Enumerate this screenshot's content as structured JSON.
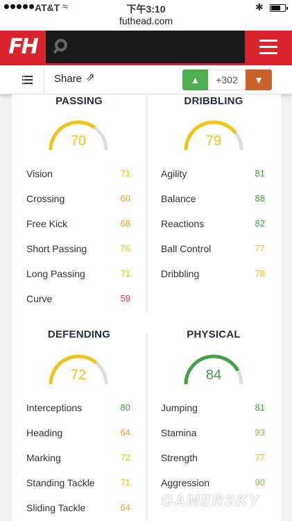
{
  "status_bar": {
    "carrier": "AT&T",
    "time": "下午3:10"
  },
  "browser": {
    "url": "futhead.com"
  },
  "header": {
    "logo_text": "FH",
    "search_placeholder": ""
  },
  "share_bar": {
    "share_label": "Share",
    "vote_count": "+302"
  },
  "colors": {
    "accent_red": "#d9232d",
    "yellow": "#f0c419",
    "light_green": "#8bc34a",
    "green": "#43a047",
    "red": "#e53935",
    "gauge_track": "#dddddd"
  },
  "sections": {
    "passing": {
      "title": "PASSING",
      "rating": "70",
      "gauge_color": "#f0c419",
      "stats": [
        {
          "name": "Vision",
          "value": "71",
          "color": "#f0c419"
        },
        {
          "name": "Crossing",
          "value": "60",
          "color": "#f0a020"
        },
        {
          "name": "Free Kick",
          "value": "68",
          "color": "#f0a020"
        },
        {
          "name": "Short Passing",
          "value": "76",
          "color": "#f0c419"
        },
        {
          "name": "Long Passing",
          "value": "71",
          "color": "#f0c419"
        },
        {
          "name": "Curve",
          "value": "59",
          "color": "#e53935"
        }
      ]
    },
    "dribbling": {
      "title": "DRIBBLING",
      "rating": "79",
      "gauge_color": "#f0c419",
      "stats": [
        {
          "name": "Agility",
          "value": "81",
          "color": "#43a047"
        },
        {
          "name": "Balance",
          "value": "88",
          "color": "#43a047"
        },
        {
          "name": "Reactions",
          "value": "82",
          "color": "#43a047"
        },
        {
          "name": "Ball Control",
          "value": "77",
          "color": "#f0c419"
        },
        {
          "name": "Dribbling",
          "value": "78",
          "color": "#f0c419"
        }
      ]
    },
    "defending": {
      "title": "DEFENDING",
      "rating": "72",
      "gauge_color": "#f0c419",
      "stats": [
        {
          "name": "Interceptions",
          "value": "80",
          "color": "#43a047"
        },
        {
          "name": "Heading",
          "value": "64",
          "color": "#f0a020"
        },
        {
          "name": "Marking",
          "value": "72",
          "color": "#f0c419"
        },
        {
          "name": "Standing Tackle",
          "value": "71",
          "color": "#f0c419"
        },
        {
          "name": "Sliding Tackle",
          "value": "64",
          "color": "#f0a020"
        }
      ]
    },
    "physical": {
      "title": "PHYSICAL",
      "rating": "84",
      "gauge_color": "#43a047",
      "stats": [
        {
          "name": "Jumping",
          "value": "81",
          "color": "#43a047"
        },
        {
          "name": "Stamina",
          "value": "93",
          "color": "#8bc34a"
        },
        {
          "name": "Strength",
          "value": "77",
          "color": "#f0c419"
        },
        {
          "name": "Aggression",
          "value": "90",
          "color": "#8bc34a"
        }
      ]
    }
  },
  "watermark": "GAMERSKY"
}
